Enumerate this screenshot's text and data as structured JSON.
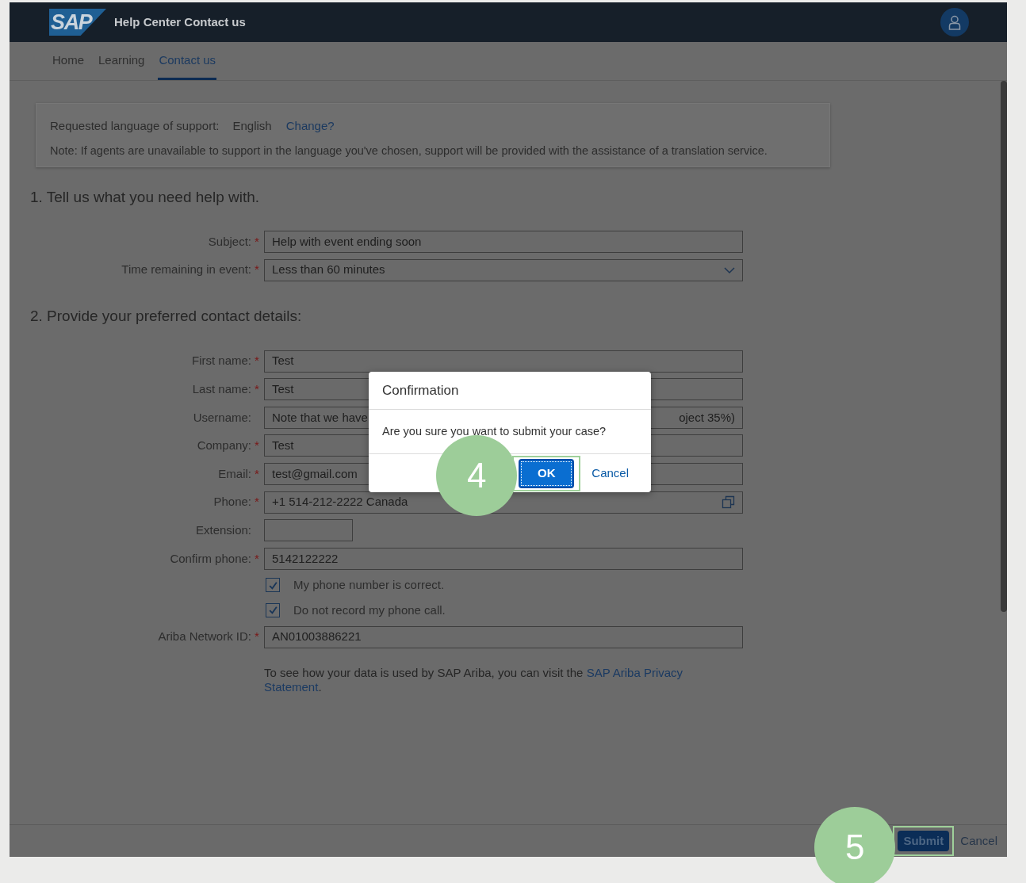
{
  "header": {
    "logo": "SAP",
    "title": "Help Center Contact us"
  },
  "tabs": [
    {
      "label": "Home",
      "selected": false
    },
    {
      "label": "Learning",
      "selected": false
    },
    {
      "label": "Contact us",
      "selected": true
    }
  ],
  "language_notice": {
    "label": "Requested language of support:",
    "value": "English",
    "link": "Change?",
    "note": "Note: If agents are unavailable to support in the language you've chosen, support will be provided with the assistance of a translation service."
  },
  "sections": [
    {
      "heading": "1. Tell us what you need help with.",
      "fields": [
        {
          "kind": "text",
          "label": "Subject:",
          "required_mark": "*",
          "value": "Help with event ending soon"
        },
        {
          "kind": "select",
          "label": "Time remaining in event:",
          "required_mark": "*",
          "value": "Less than 60 minutes"
        }
      ]
    },
    {
      "heading": "2. Provide your preferred contact details:",
      "fields": [
        {
          "kind": "text",
          "label": "First name:",
          "required_mark": "*",
          "value": "Test"
        },
        {
          "kind": "text",
          "label": "Last name:",
          "required_mark": "*",
          "value": "Test"
        },
        {
          "kind": "text",
          "label": "Username:",
          "value": "Note that we have",
          "value_end": "oject 35%)"
        },
        {
          "kind": "text",
          "label": "Company:",
          "required_mark": "*",
          "value": "Test"
        },
        {
          "kind": "text",
          "label": "Email:",
          "required_mark": "*",
          "value": "test@gmail.com"
        },
        {
          "kind": "phone",
          "label": "Phone:",
          "required_mark": "*",
          "value": "+1 514-212-2222 Canada"
        },
        {
          "kind": "short",
          "label": "Extension:"
        },
        {
          "kind": "text",
          "label": "Confirm phone:",
          "required_mark": "*",
          "value": "5142122222"
        },
        {
          "kind": "checkbox",
          "label": "My phone number is correct.",
          "checked": true
        },
        {
          "kind": "checkbox",
          "label": "Do not record my phone call.",
          "checked": true
        },
        {
          "kind": "text",
          "label": "Ariba Network ID:",
          "required_mark": "*",
          "value": "AN01003886221"
        }
      ]
    }
  ],
  "privacy": {
    "text": "To see how your data is used by SAP Ariba, you can visit the",
    "link_lines": [
      "SAP Ariba Privacy",
      "Statement"
    ],
    "after": "."
  },
  "footer_buttons": [
    {
      "label": "Submit",
      "kind": "primary",
      "highlighted": true,
      "step": "5"
    },
    {
      "label": "Cancel",
      "kind": "link",
      "highlighted": false
    }
  ],
  "dialog": {
    "title": "Confirmation",
    "message": "Are you sure you want to submit your case?",
    "buttons": [
      {
        "label": "OK",
        "kind": "primary",
        "highlighted": true,
        "step": "4"
      },
      {
        "label": "Cancel",
        "kind": "link",
        "highlighted": false
      }
    ]
  }
}
